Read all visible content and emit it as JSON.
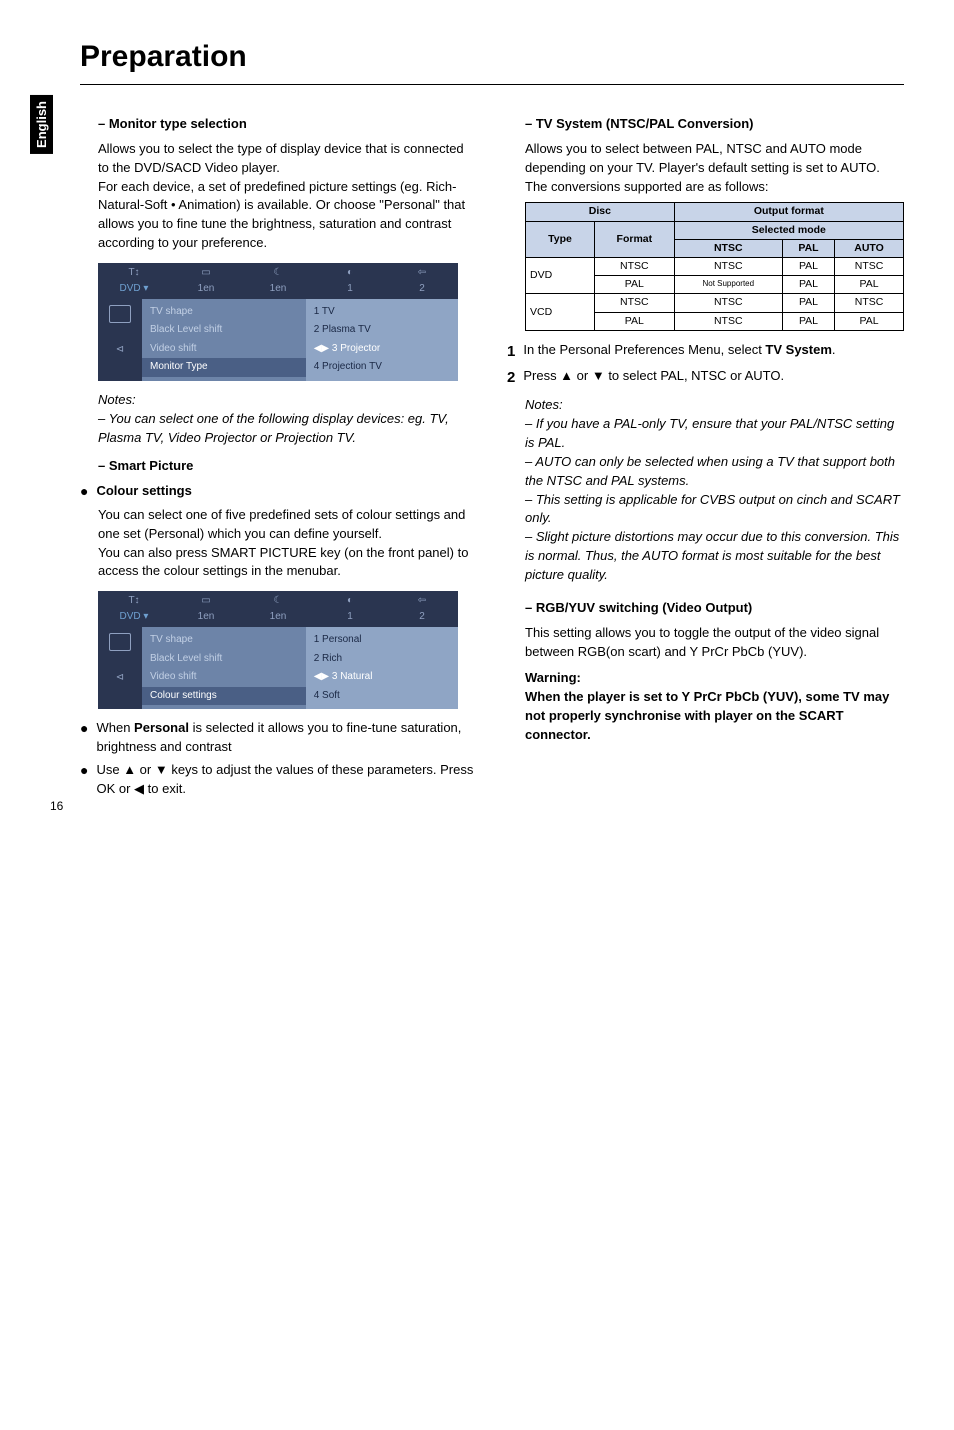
{
  "side_tab": "English",
  "title": "Preparation",
  "page_number": "16",
  "left": {
    "h1": "–   Monitor type selection",
    "p1": "Allows you to select the type of display device that is connected to the DVD/SACD Video player.",
    "p2": "For each device, a set of predefined picture settings (eg. Rich-Natural-Soft • Animation) is available. Or choose \"Personal\" that allows you to fine tune the brightness, saturation and contrast according to your preference.",
    "ss1": {
      "top_labels": [
        "1en",
        "1en",
        "1",
        "2"
      ],
      "mid": [
        "TV shape",
        "Black Level shift",
        "Video shift"
      ],
      "mid_hl": "Monitor Type",
      "right": [
        "1 TV",
        "2 Plasma TV",
        "3 Projector",
        "4 Projection TV"
      ],
      "right_sel": 2
    },
    "notes_h": "Notes:",
    "notes_p": "–    You can select one of the following display devices: eg. TV, Plasma TV, Video Projector or Projection TV.",
    "h2": "–   Smart Picture",
    "h3": "Colour settings",
    "p3": "You can select one of five predefined sets of colour settings and one set (Personal) which you can define yourself.",
    "p4": "You can also press SMART PICTURE key (on the front panel) to access the colour settings in the menubar.",
    "ss2": {
      "top_labels": [
        "1en",
        "1en",
        "1",
        "2"
      ],
      "mid": [
        "TV shape",
        "Black Level shift",
        "Video shift"
      ],
      "mid_hl": "Colour settings",
      "right": [
        "1 Personal",
        "2 Rich",
        "3 Natural",
        "4 Soft"
      ],
      "right_sel": 2
    },
    "b1_pre": "When ",
    "b1_bold": "Personal",
    "b1_post": " is selected it allows you to fine-tune saturation, brightness and contrast",
    "b2": "Use ▲ or ▼ keys to adjust the values of these parameters. Press OK or ◀ to exit."
  },
  "right": {
    "h1": "–   TV System (NTSC/PAL Conversion)",
    "p1": "Allows you to select between PAL, NTSC and AUTO mode depending on your TV. Player's default setting is set to AUTO.",
    "p2": "The conversions supported are as follows:",
    "table": {
      "head_disc": "Disc",
      "head_output": "Output format",
      "type": "Type",
      "format": "Format",
      "selected": "Selected mode",
      "cols": [
        "NTSC",
        "PAL",
        "AUTO"
      ],
      "rows": [
        {
          "type": "DVD",
          "fmt": "NTSC",
          "c": [
            "NTSC",
            "PAL",
            "NTSC"
          ]
        },
        {
          "type": "",
          "fmt": "PAL",
          "c": [
            "Not Supported",
            "PAL",
            "PAL"
          ]
        },
        {
          "type": "VCD",
          "fmt": "NTSC",
          "c": [
            "NTSC",
            "PAL",
            "NTSC"
          ]
        },
        {
          "type": "",
          "fmt": "PAL",
          "c": [
            "NTSC",
            "PAL",
            "PAL"
          ]
        }
      ]
    },
    "s1_pre": "In the Personal Preferences Menu, select ",
    "s1_bold": "TV System",
    "s1_post": ".",
    "s2": "Press ▲ or ▼ to select PAL, NTSC or AUTO.",
    "notes_h": "Notes:",
    "n1": "–    If you have a PAL-only TV, ensure that your PAL/NTSC setting is PAL.",
    "n2": "–    AUTO can only be selected when using a TV that support both the NTSC and PAL systems.",
    "n3": "–    This setting is applicable for CVBS output on cinch and SCART only.",
    "n4": "–    Slight picture distortions may occur due to this conversion. This is normal. Thus, the AUTO format is most suitable for the best picture quality.",
    "h2": "– RGB/YUV switching (Video Output)",
    "p3": "This setting allows you to toggle the output of the video signal between RGB(on scart) and Y PrCr PbCb (YUV).",
    "warn_h": "Warning:",
    "warn_p": "When the player is set to Y PrCr PbCb (YUV), some TV may not properly synchronise with player on the SCART connector."
  }
}
